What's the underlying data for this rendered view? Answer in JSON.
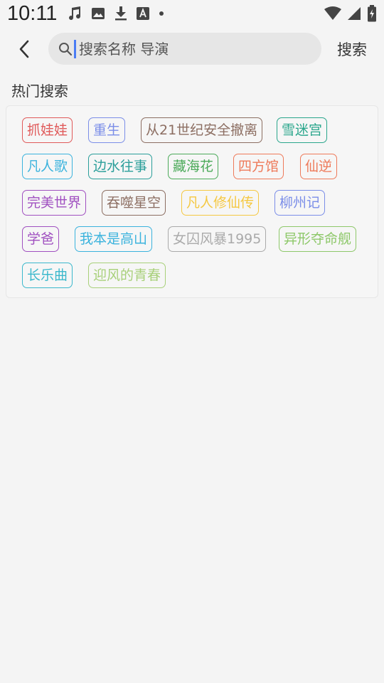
{
  "status_bar": {
    "time": "10:11",
    "left_icons": [
      "music-note-icon",
      "image-icon",
      "download-icon",
      "font-a-icon",
      "dot-icon"
    ],
    "right_icons": [
      "wifi-icon",
      "cell-signal-icon",
      "battery-charging-icon"
    ]
  },
  "header": {
    "search_placeholder": "搜索名称 导演",
    "search_button": "搜索"
  },
  "hot_search": {
    "title": "热门搜索",
    "tags": [
      {
        "label": "抓娃娃",
        "color": "#e05a5a"
      },
      {
        "label": "重生",
        "color": "#7b8ee8"
      },
      {
        "label": "从21世纪安全撤离",
        "color": "#8c6e62"
      },
      {
        "label": "雪迷宫",
        "color": "#2aa68c"
      },
      {
        "label": "凡人歌",
        "color": "#3bb3dd"
      },
      {
        "label": "边水往事",
        "color": "#2a9e9a"
      },
      {
        "label": "藏海花",
        "color": "#4caa5a"
      },
      {
        "label": "四方馆",
        "color": "#ee7a5a"
      },
      {
        "label": "仙逆",
        "color": "#ee7a5a"
      },
      {
        "label": "完美世界",
        "color": "#a050c0"
      },
      {
        "label": "吞噬星空",
        "color": "#8c6e62"
      },
      {
        "label": "凡人修仙传",
        "color": "#f5c842"
      },
      {
        "label": "柳州记",
        "color": "#7b8ee8"
      },
      {
        "label": "学爸",
        "color": "#a050c0"
      },
      {
        "label": "我本是高山",
        "color": "#3bb3dd"
      },
      {
        "label": "女囚风暴1995",
        "color": "#aaaaaa"
      },
      {
        "label": "异形夺命舰",
        "color": "#8ec86a"
      },
      {
        "label": "长乐曲",
        "color": "#3bb8cc"
      },
      {
        "label": "迎风的青春",
        "color": "#a8d07a"
      }
    ]
  }
}
